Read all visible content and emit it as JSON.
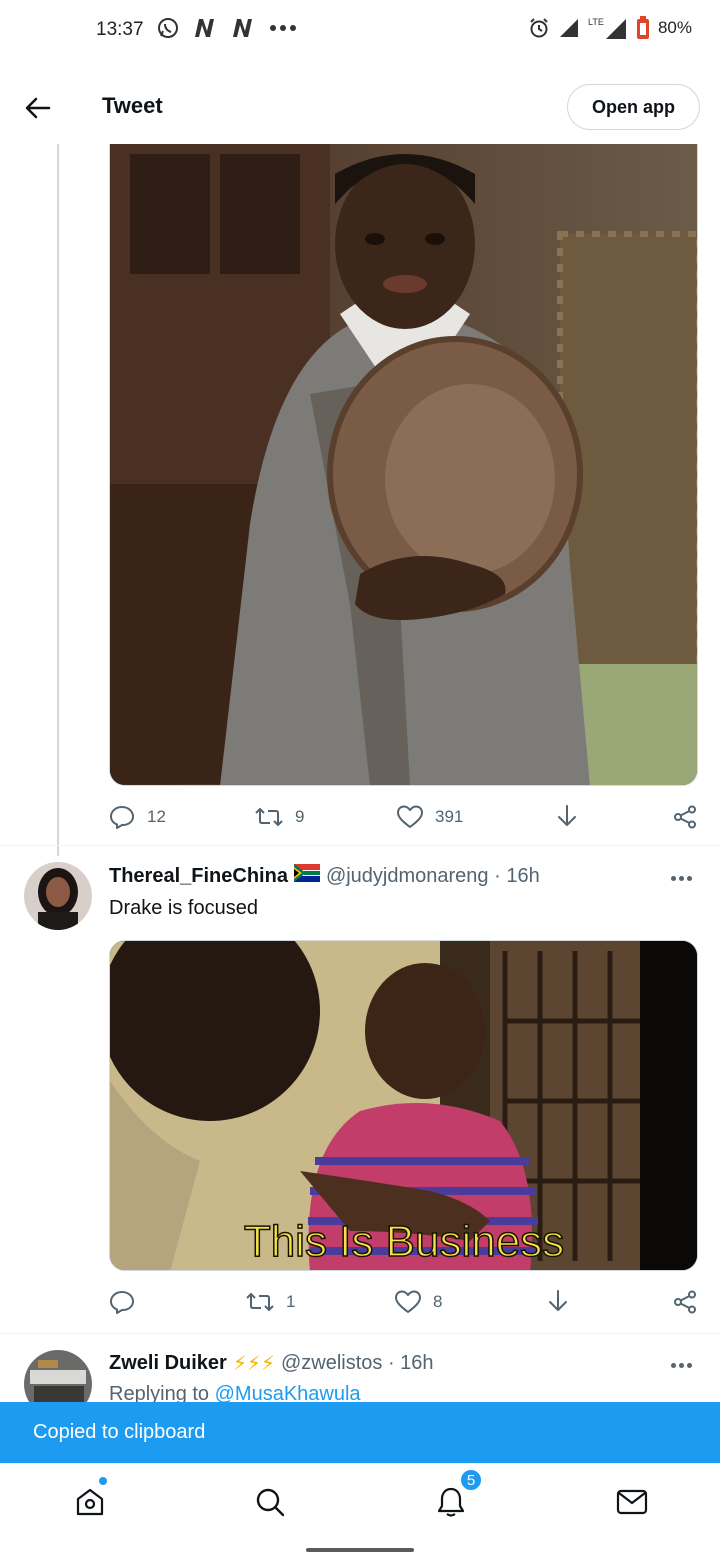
{
  "status_bar": {
    "time": "13:37",
    "battery": "80%",
    "network": "LTE"
  },
  "header": {
    "title": "Tweet",
    "open_app_label": "Open app"
  },
  "tweet_top": {
    "actions": {
      "replies": "12",
      "retweets": "9",
      "likes": "391"
    }
  },
  "tweet_reply1": {
    "name": "Thereal_FineChina",
    "handle": "@judyjdmonareng · 16h",
    "text": "Drake is focused",
    "media_caption": "This Is Business",
    "actions": {
      "replies": "",
      "retweets": "1",
      "likes": "8"
    }
  },
  "tweet_reply2": {
    "name": "Zweli Duiker",
    "emoji": "⚡⚡⚡",
    "handle": "@zwelistos · 16h",
    "replying_prefix": "Replying to",
    "replying_to": "@MusaKhawula"
  },
  "toast": {
    "text": "Copied to clipboard"
  },
  "bottom_nav": {
    "notification_count": "5"
  },
  "colors": {
    "accent": "#1d9bf0",
    "text_secondary": "#536471",
    "border": "#cfd9de"
  }
}
